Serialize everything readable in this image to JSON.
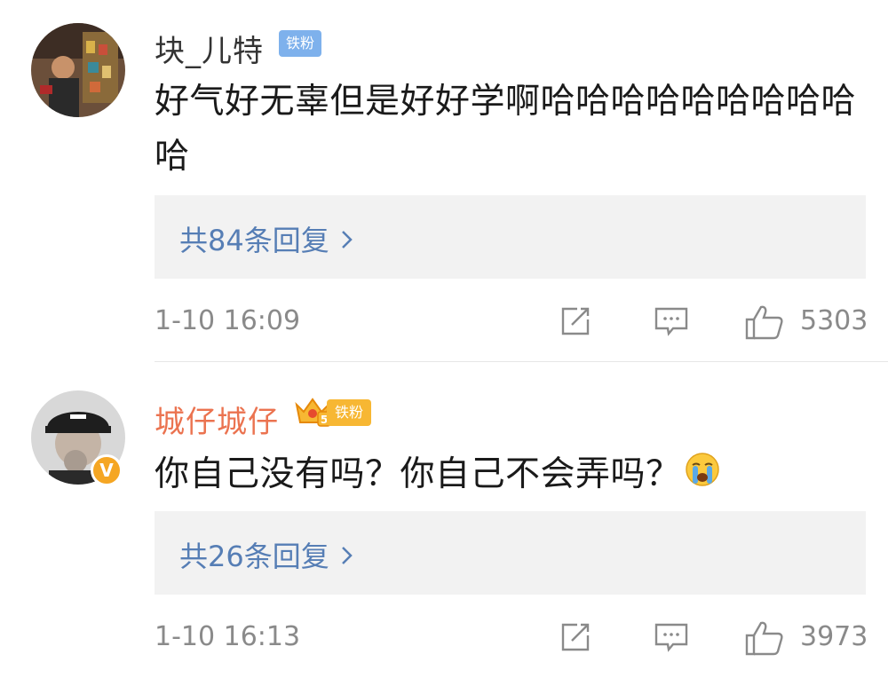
{
  "comments": [
    {
      "username": "块_儿特",
      "fan_badge": "铁粉",
      "text": "好气好无辜但是好好学啊哈哈哈哈哈哈哈哈哈哈",
      "replies_label": "共84条回复",
      "time": "1-10 16:09",
      "likes": "5303",
      "name_color": "#333333",
      "badge_color": "#7eb1ec",
      "verified": false
    },
    {
      "username": "城仔城仔",
      "fan_badge": "铁粉",
      "text": "你自己没有吗？你自己不会弄吗？",
      "emoji": "crying-face-emoji",
      "replies_label": "共26条回复",
      "time": "1-10 16:13",
      "likes": "3973",
      "name_color": "#eb7350",
      "badge_color": "#f7b733",
      "verified": true,
      "crown_level": "5"
    }
  ],
  "icons": {
    "forward": "forward-icon",
    "comment": "comment-icon",
    "like": "thumbs-up-icon",
    "reply_chevron": "chevron-right-icon"
  },
  "link_color": "#567eb5"
}
